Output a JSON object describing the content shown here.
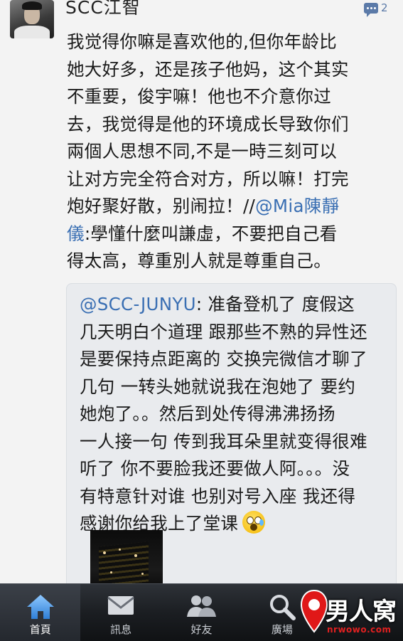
{
  "post": {
    "username": "SCC江智",
    "comment_count": "2",
    "text_lines": [
      "我觉得你嘛是喜欢他的,但你年龄比",
      "她大好多，还是孩子他妈，这个其实",
      "不重要，俊宇嘛！他也不介意你过",
      "去，我觉得是他的环境成长导致你们",
      "兩個人思想不同,不是一時三刻可以",
      "让对方完全符合对方，所以嘛！打完",
      "炮好聚好散，别闹拉！//"
    ],
    "mention": "@Mia陳靜",
    "mention_cont": "儀",
    "quote_after": ":學懂什麼叫謙虛，不要把自己看",
    "last_line": "得太高，尊重別人就是尊重自己。"
  },
  "repost": {
    "mention": "@SCC-JUNYU",
    "first_rest": ": 准备登机了 度假这",
    "lines": [
      "几天明白个道理 跟那些不熟的异性还",
      "是要保持点距离的 交换完微信才聊了",
      "几句 一转头她就说我在泡她了 要约",
      "她炮了。。然后到处传得沸沸扬扬",
      "一人接一句 传到我耳朵里就变得很难",
      "听了 你不要脸我还要做人阿。。。没",
      "有特意针对谁 也别对号入座 我还得"
    ],
    "last_line": "感谢你给我上了堂课"
  },
  "tabbar": {
    "tabs": [
      {
        "label": "首頁",
        "icon": "home-icon"
      },
      {
        "label": "訊息",
        "icon": "envelope-icon"
      },
      {
        "label": "好友",
        "icon": "friends-icon"
      },
      {
        "label": "廣場",
        "icon": "search-icon"
      }
    ]
  },
  "watermark": {
    "brand": "男人窝",
    "url": "nrwowo.com"
  },
  "colors": {
    "link": "#3a6fb3",
    "tabbar": "#1b1e22",
    "badge": "#5b7aa8"
  }
}
